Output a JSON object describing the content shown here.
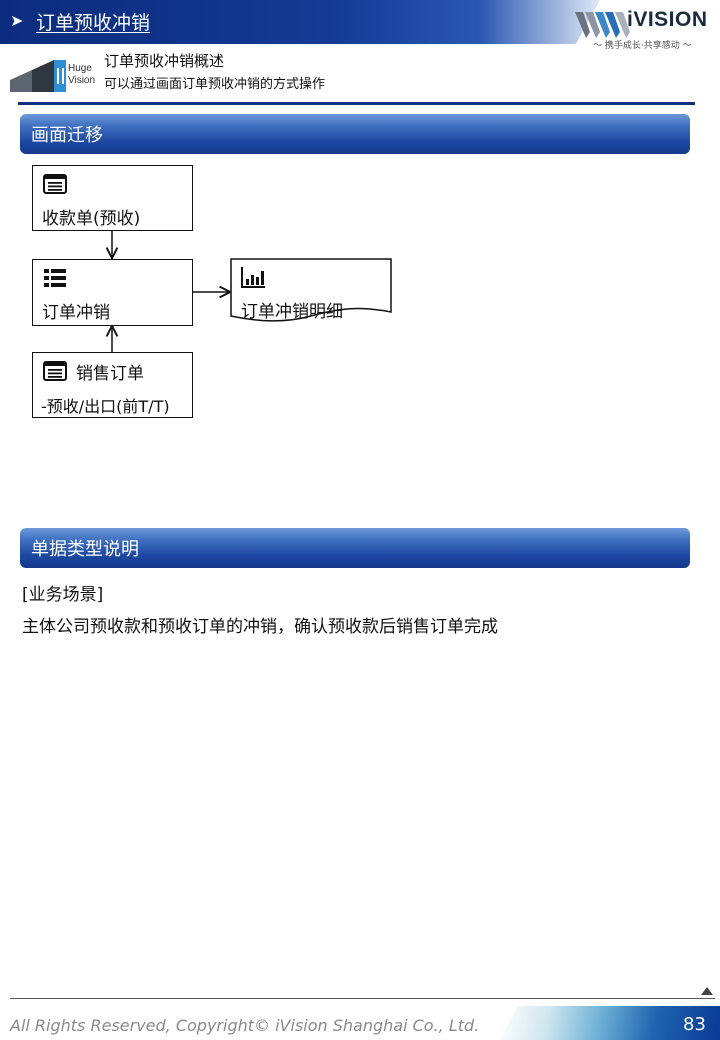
{
  "header": {
    "title": "订单预收冲销",
    "brand_name": "iVISION",
    "slogan": "～ 携手成长·共享感动 ～",
    "brand_colors": [
      "#0b2c7e",
      "#2b57b1"
    ]
  },
  "overview": {
    "logo_line1": "Huge",
    "logo_line2": "Vision",
    "title": "订单预收冲销概述",
    "subtitle": "可以通过画面订单预收冲销的方式操作"
  },
  "sections": {
    "flow_title": "画面迁移",
    "doc_type_title": "单据类型说明"
  },
  "flow": {
    "receipt": {
      "label": "收款单(预收)",
      "icon": "list-window-icon"
    },
    "offset": {
      "label": "订单冲销",
      "icon": "bullet-list-icon"
    },
    "detail": {
      "label": "订单冲销明细",
      "icon": "bar-chart-icon"
    },
    "sales_order": {
      "label": "销售订单",
      "label2": "-预收/出口(前T/T)",
      "icon": "list-window-icon"
    }
  },
  "doc_type": {
    "scenario_heading": "[业务场景]",
    "scenario_text": "主体公司预收款和预收订单的冲销，确认预收款后销售订单完成"
  },
  "footer": {
    "copyright": "All Rights Reserved, Copyright© iVision Shanghai Co., Ltd.",
    "page_number": "83"
  }
}
